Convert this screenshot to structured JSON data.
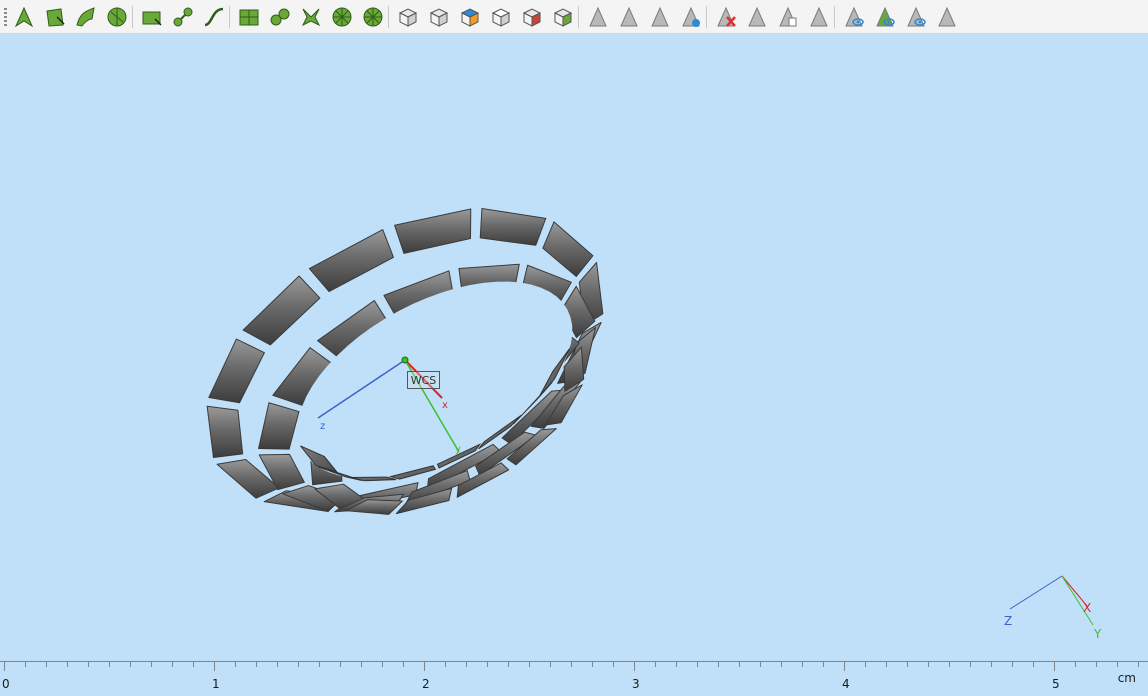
{
  "toolbar": {
    "groups": [
      [
        "arrow-select-icon",
        "rect-select-icon",
        "lasso-select-icon",
        "circle-select-icon"
      ],
      [
        "rect-pick-icon",
        "node-pick-icon",
        "curve-pick-icon"
      ],
      [
        "grid-pick-icon",
        "blob-pick-icon",
        "flower-pick-icon",
        "wheel-pick-icon",
        "wheel-small-pick-icon"
      ],
      [
        "cube-front-icon",
        "cube-top-icon",
        "cube-color-icon",
        "cube-wire-icon",
        "cube-red-icon",
        "cube-green-icon"
      ],
      [
        "gray-arrow-icon",
        "gray-arrow-2-icon",
        "gray-arrow-3-icon",
        "triangle-blue-icon"
      ],
      [
        "delete-triangle-icon",
        "triangle-gray-icon",
        "triangle-copy-icon",
        "triangle-blank-icon"
      ],
      [
        "eye-triangle-icon",
        "blue-eye-triangle-icon",
        "eye-triangle-2-icon",
        "hidden-triangle-icon"
      ]
    ]
  },
  "viewport": {
    "wcs_label": "WCS",
    "wcs_axis_x": "x",
    "wcs_axis_y": "y",
    "wcs_axis_z": "z",
    "gizmo_x": "X",
    "gizmo_y": "Y",
    "gizmo_z": "Z"
  },
  "ruler": {
    "labels": [
      "0",
      "1",
      "2",
      "3",
      "4",
      "5"
    ],
    "unit": "cm"
  },
  "colors": {
    "background": "#bfe0f8",
    "toolbar_bg": "#f4f4f4",
    "icon_green": "#6aa83a",
    "icon_dark": "#2f5e17",
    "ring_gray": "#6e6e6e",
    "axis_x": "#d22",
    "axis_y": "#3cbf2c",
    "axis_z": "#3a62c8"
  }
}
